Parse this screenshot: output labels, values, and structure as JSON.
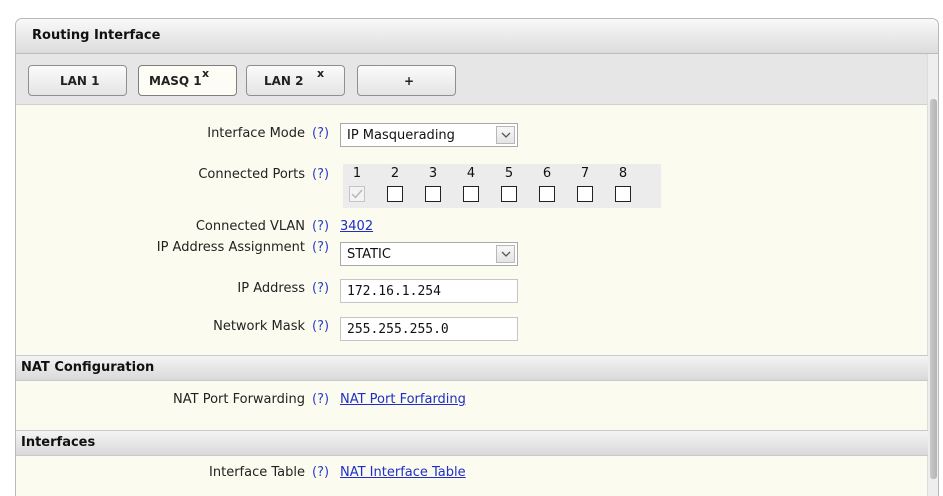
{
  "panel": {
    "title": "Routing Interface"
  },
  "tabs": [
    {
      "label": "LAN 1",
      "closable": false,
      "active": false
    },
    {
      "label": "MASQ 1",
      "closable": true,
      "active": true
    },
    {
      "label": "LAN 2",
      "closable": true,
      "active": false
    },
    {
      "label": "+",
      "closable": false,
      "active": false
    }
  ],
  "tab_close_glyph": "x",
  "help_text": "(?)",
  "fields": {
    "interface_mode": {
      "label": "Interface Mode",
      "value": "IP Masquerading"
    },
    "connected_ports": {
      "label": "Connected Ports",
      "ports": [
        "1",
        "2",
        "3",
        "4",
        "5",
        "6",
        "7",
        "8"
      ],
      "checked": [
        true,
        false,
        false,
        false,
        false,
        false,
        false,
        false
      ]
    },
    "connected_vlan": {
      "label": "Connected VLAN",
      "value": "3402"
    },
    "ip_assignment": {
      "label": "IP Address Assignment",
      "value": "STATIC"
    },
    "ip_address": {
      "label": "IP Address",
      "value": "172.16.1.254"
    },
    "network_mask": {
      "label": "Network Mask",
      "value": "255.255.255.0"
    }
  },
  "nat_section": {
    "title": "NAT Configuration",
    "port_forwarding": {
      "label": "NAT Port Forwarding",
      "link": "NAT Port Forfarding"
    }
  },
  "interfaces_section": {
    "title": "Interfaces",
    "interface_table": {
      "label": "Interface Table",
      "link": "NAT Interface Table"
    }
  },
  "colors": {
    "panel_bg": "#fbfbef",
    "link": "#1f2fc6",
    "help": "#2b3fc9",
    "ports_bg": "#ececec"
  },
  "icons": {
    "dropdown": "chevron-down-icon",
    "checkmark": "checkmark-icon",
    "close": "close-icon"
  }
}
